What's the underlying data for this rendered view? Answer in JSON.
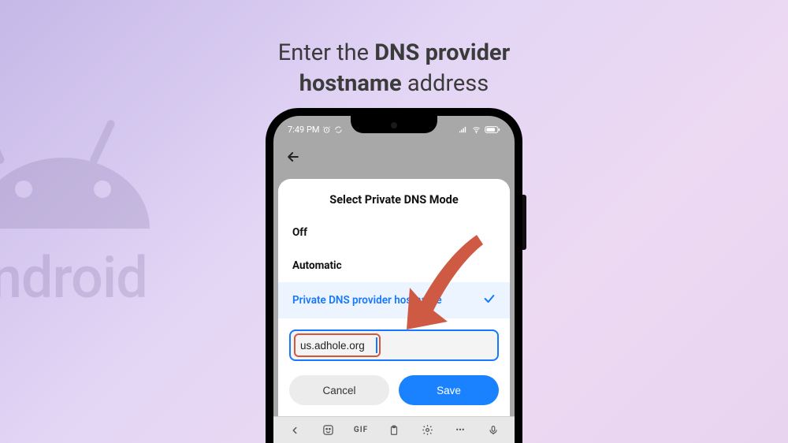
{
  "headline": {
    "pre": "Enter the ",
    "bold1": "DNS provider",
    "mid_break": true,
    "bold2": "hostname",
    "post": " address"
  },
  "background_wordmark": "android",
  "status": {
    "time": "7:49 PM"
  },
  "card": {
    "title": "Select Private DNS Mode",
    "options": {
      "off": "Off",
      "auto": "Automatic",
      "hostname": "Private DNS provider hostname"
    },
    "input_value": "us.adhole.org",
    "cancel": "Cancel",
    "save": "Save"
  },
  "kbd": {
    "gif": "GIF",
    "dots": "•••"
  },
  "colors": {
    "accent": "#1677ff",
    "arrow": "#cf5a44"
  }
}
